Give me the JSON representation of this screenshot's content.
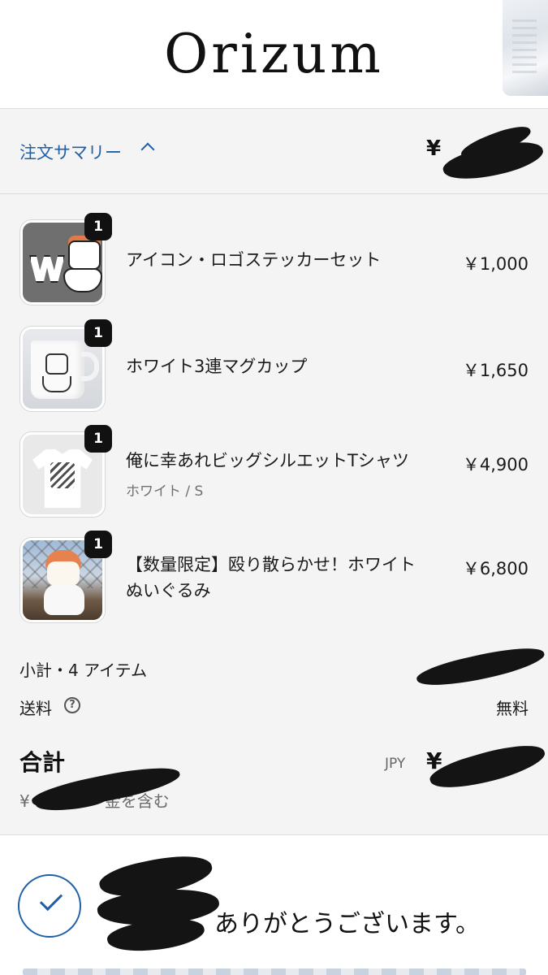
{
  "header": {
    "logo_text": "Orizum"
  },
  "summary": {
    "toggle_label": "注文サマリー",
    "total_prefix": "¥"
  },
  "items": [
    {
      "name_lines": [
        "アイコン・ロゴステッカーセット"
      ],
      "variant": "",
      "price": "￥1,000",
      "quantity": "1",
      "thumb_icon": "sticker-set-thumb"
    },
    {
      "name_lines": [
        "ホワイト3連マグカップ"
      ],
      "variant": "",
      "price": "￥1,650",
      "quantity": "1",
      "thumb_icon": "mug-thumb"
    },
    {
      "name_lines": [
        "俺に幸あれビッグシルエットTシャツ"
      ],
      "variant": "ホワイト / S",
      "price": "￥4,900",
      "quantity": "1",
      "thumb_icon": "tshirt-thumb"
    },
    {
      "name_lines": [
        "【数量限定】殴り散らかせ！ホワイト",
        "ぬいぐるみ"
      ],
      "variant": "",
      "price": "￥6,800",
      "quantity": "1",
      "thumb_icon": "plush-doll-thumb"
    }
  ],
  "totals": {
    "subtotal_label": "小計・4 アイテム",
    "shipping_label": "送料",
    "help_glyph": "?",
    "shipping_value": "無料",
    "total_label": "合計",
    "currency_code": "JPY",
    "total_prefix": "¥",
    "tax_note_prefix": "¥",
    "tax_note_suffix": "金を含む"
  },
  "thanks": {
    "message": "ありがとうございます。"
  },
  "colors": {
    "accent": "#1f5fa8",
    "summary_bg": "#f4f4f4",
    "badge_bg": "#111111"
  }
}
